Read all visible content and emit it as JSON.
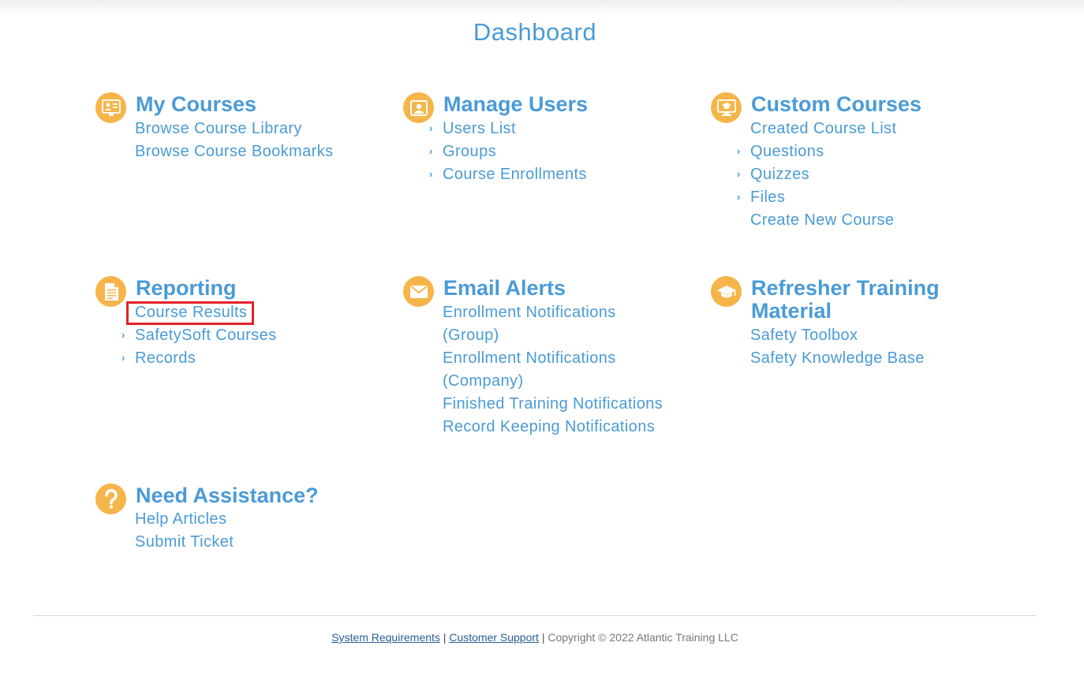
{
  "page": {
    "title": "Dashboard"
  },
  "sections": {
    "my_courses": {
      "icon": "courses-board-icon",
      "title": "My Courses",
      "links": [
        "Browse Course Library",
        "Browse Course Bookmarks"
      ]
    },
    "manage_users": {
      "icon": "user-card-icon",
      "title": "Manage Users",
      "links": [
        "Users List",
        "Groups",
        "Course Enrollments"
      ]
    },
    "custom_courses": {
      "icon": "monitor-graduation-icon",
      "title": "Custom Courses",
      "links": [
        "Created Course List",
        "Questions",
        "Quizzes",
        "Files",
        "Create New Course"
      ]
    },
    "reporting": {
      "icon": "report-document-icon",
      "title": "Reporting",
      "links": [
        "Course Results",
        "SafetySoft Courses",
        "Records"
      ]
    },
    "email_alerts": {
      "icon": "envelope-icon",
      "title": "Email Alerts",
      "links": [
        "Enrollment Notifications (Group)",
        "Enrollment Notifications (Company)",
        "Finished Training Notifications",
        "Record Keeping Notifications"
      ]
    },
    "refresher": {
      "icon": "graduation-cap-icon",
      "title": "Refresher Training Material",
      "links": [
        "Safety Toolbox",
        "Safety Knowledge Base"
      ]
    },
    "assistance": {
      "icon": "question-mark-icon",
      "title": "Need Assistance?",
      "links": [
        "Help Articles",
        "Submit Ticket"
      ]
    }
  },
  "footer": {
    "system_requirements": "System Requirements",
    "separator": "|",
    "customer_support": "Customer Support",
    "copyright": "Copyright © 2022 Atlantic Training LLC"
  },
  "colors": {
    "accent": "#4a9bd6",
    "icon_bg": "#f6b54a",
    "highlight": "#e32129",
    "footer_link": "#2a5f93"
  }
}
